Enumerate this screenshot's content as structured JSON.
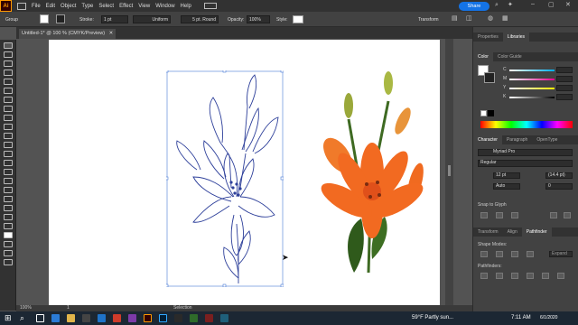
{
  "app": {
    "logo": "Ai"
  },
  "menu": [
    "File",
    "Edit",
    "Object",
    "Type",
    "Select",
    "Effect",
    "View",
    "Window",
    "Help"
  ],
  "share_label": "Share",
  "control": {
    "mode": "Group",
    "stroke_label": "Stroke:",
    "stroke_value": "1 pt",
    "profile": "Uniform",
    "brush": "5 pt. Round",
    "opacity_label": "Opacity:",
    "opacity_value": "100%",
    "style_label": "Style:",
    "transform": "Transform"
  },
  "document": {
    "tab": "Untitled-1* @ 100 % (CMYK/Preview)"
  },
  "status": {
    "zoom": "100%",
    "page": "1",
    "tool": "Selection"
  },
  "panel": {
    "top_tabs": [
      "Properties",
      "Libraries"
    ],
    "color_tabs": [
      "Color",
      "Color Guide"
    ],
    "color_rows": [
      "C",
      "M",
      "Y",
      "K"
    ],
    "char_tabs": [
      "Character",
      "Paragraph",
      "OpenType"
    ],
    "font_family": "Myriad Pro",
    "font_style": "Regular",
    "font_size": "12 pt",
    "leading": "(14.4 pt)",
    "kerning": "Auto",
    "tracking": "0",
    "snap": "Snap to Glyph",
    "bottom_tabs": [
      "Transform",
      "Align",
      "Pathfinder"
    ],
    "shape_modes": "Shape Modes:",
    "pathfinders": "Pathfinders:",
    "expand": "Expand"
  },
  "taskbar": {
    "weather": "59°F  Partly sun...",
    "time": "7:11 AM",
    "date": "6/1/2020"
  },
  "colors": {
    "accent": "#1473e6",
    "ai_orange": "#ff9a00",
    "flower": "#f26a21"
  }
}
